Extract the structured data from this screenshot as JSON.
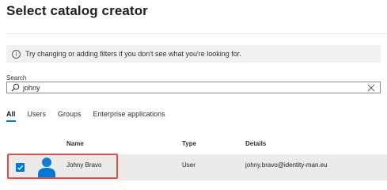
{
  "page": {
    "title": "Select catalog creator"
  },
  "info_bar": {
    "icon": "info-icon",
    "text": "Try changing or adding filters if you don't see what you're looking for."
  },
  "search": {
    "label": "Search",
    "value": "johny",
    "icon": "search-icon",
    "clear_icon": "close-icon"
  },
  "tabs": [
    {
      "label": "All",
      "active": true
    },
    {
      "label": "Users",
      "active": false
    },
    {
      "label": "Groups",
      "active": false
    },
    {
      "label": "Enterprise applications",
      "active": false
    }
  ],
  "table": {
    "columns": {
      "name": "Name",
      "type": "Type",
      "details": "Details"
    },
    "rows": [
      {
        "selected": true,
        "avatar_icon": "user-icon",
        "name": "Johny Bravo",
        "type": "User",
        "details": "johny.bravo@identity-man.eu"
      }
    ]
  },
  "colors": {
    "accent": "#0078d4",
    "highlight": "#d9534f",
    "selected_row": "#edebe9",
    "info_bg": "#eef0f2"
  }
}
